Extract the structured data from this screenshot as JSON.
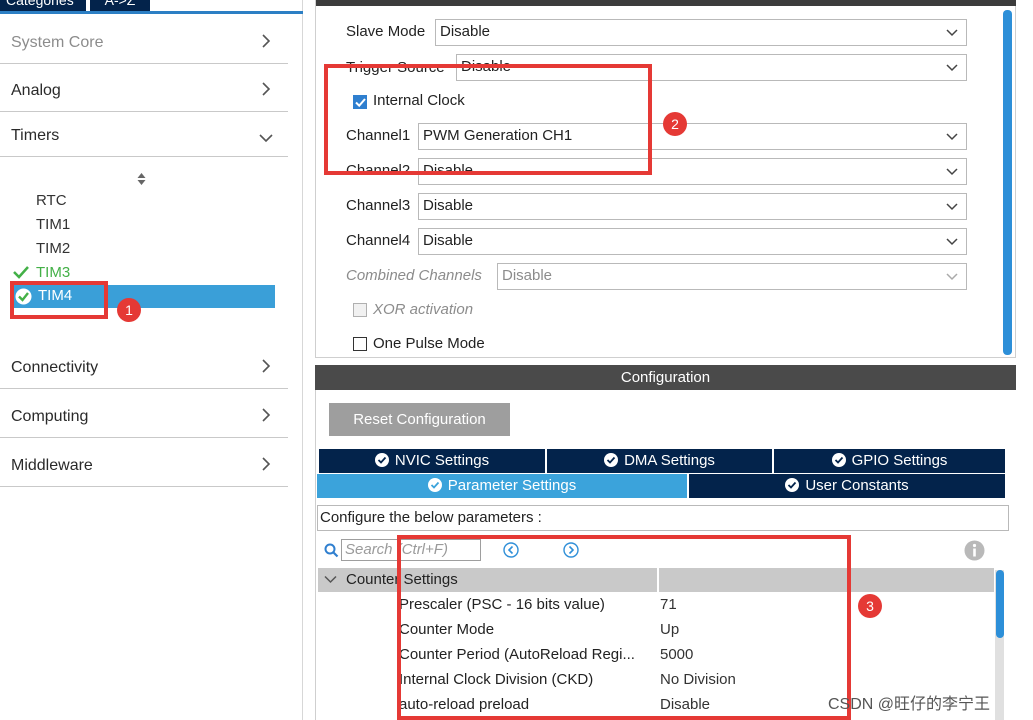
{
  "left": {
    "tabs": [
      "Categories",
      "A->Z"
    ],
    "categories": [
      {
        "label": "System Core",
        "state": "collapsed",
        "disabled": true
      },
      {
        "label": "Analog",
        "state": "collapsed"
      },
      {
        "label": "Timers",
        "state": "expanded"
      },
      {
        "label": "Connectivity",
        "state": "collapsed"
      },
      {
        "label": "Computing",
        "state": "collapsed"
      },
      {
        "label": "Middleware",
        "state": "collapsed"
      }
    ],
    "timers": [
      "RTC",
      "TIM1",
      "TIM2",
      "TIM3",
      "TIM4"
    ],
    "selected_timer": "TIM4",
    "configured_color": "#43b047",
    "selected_color": "#3a9fd8"
  },
  "mode": {
    "slave_mode": {
      "label": "Slave Mode",
      "value": "Disable"
    },
    "trigger_source": {
      "label": "Trigger Source",
      "value": "Disable"
    },
    "internal_clock": {
      "label": "Internal Clock",
      "checked": true
    },
    "channel1": {
      "label": "Channel1",
      "value": "PWM Generation CH1"
    },
    "channel2": {
      "label": "Channel2",
      "value": "Disable"
    },
    "channel3": {
      "label": "Channel3",
      "value": "Disable"
    },
    "channel4": {
      "label": "Channel4",
      "value": "Disable"
    },
    "combined_channels": {
      "label": "Combined Channels",
      "value": "Disable"
    },
    "xor_activation": {
      "label": "XOR activation",
      "checked": false
    },
    "one_pulse_mode": {
      "label": "One Pulse Mode",
      "checked": false
    }
  },
  "config": {
    "title": "Configuration",
    "reset_label": "Reset Configuration",
    "tabs_row1": [
      "NVIC Settings",
      "DMA Settings",
      "GPIO Settings"
    ],
    "tabs_row2": [
      "Parameter Settings",
      "User Constants"
    ],
    "active_tab": "Parameter Settings",
    "description": "Configure the below parameters :",
    "search_placeholder": "Search (Ctrl+F)",
    "group": "Counter Settings",
    "params": [
      {
        "name": "Prescaler (PSC - 16 bits value)",
        "value": "71"
      },
      {
        "name": "Counter Mode",
        "value": "Up"
      },
      {
        "name": "Counter Period (AutoReload Regi...",
        "value": "5000"
      },
      {
        "name": "Internal Clock Division (CKD)",
        "value": "No Division"
      },
      {
        "name": "auto-reload preload",
        "value": "Disable"
      }
    ]
  },
  "annotations": [
    "1",
    "2",
    "3"
  ],
  "watermark": "CSDN @旺仔的李宁王"
}
